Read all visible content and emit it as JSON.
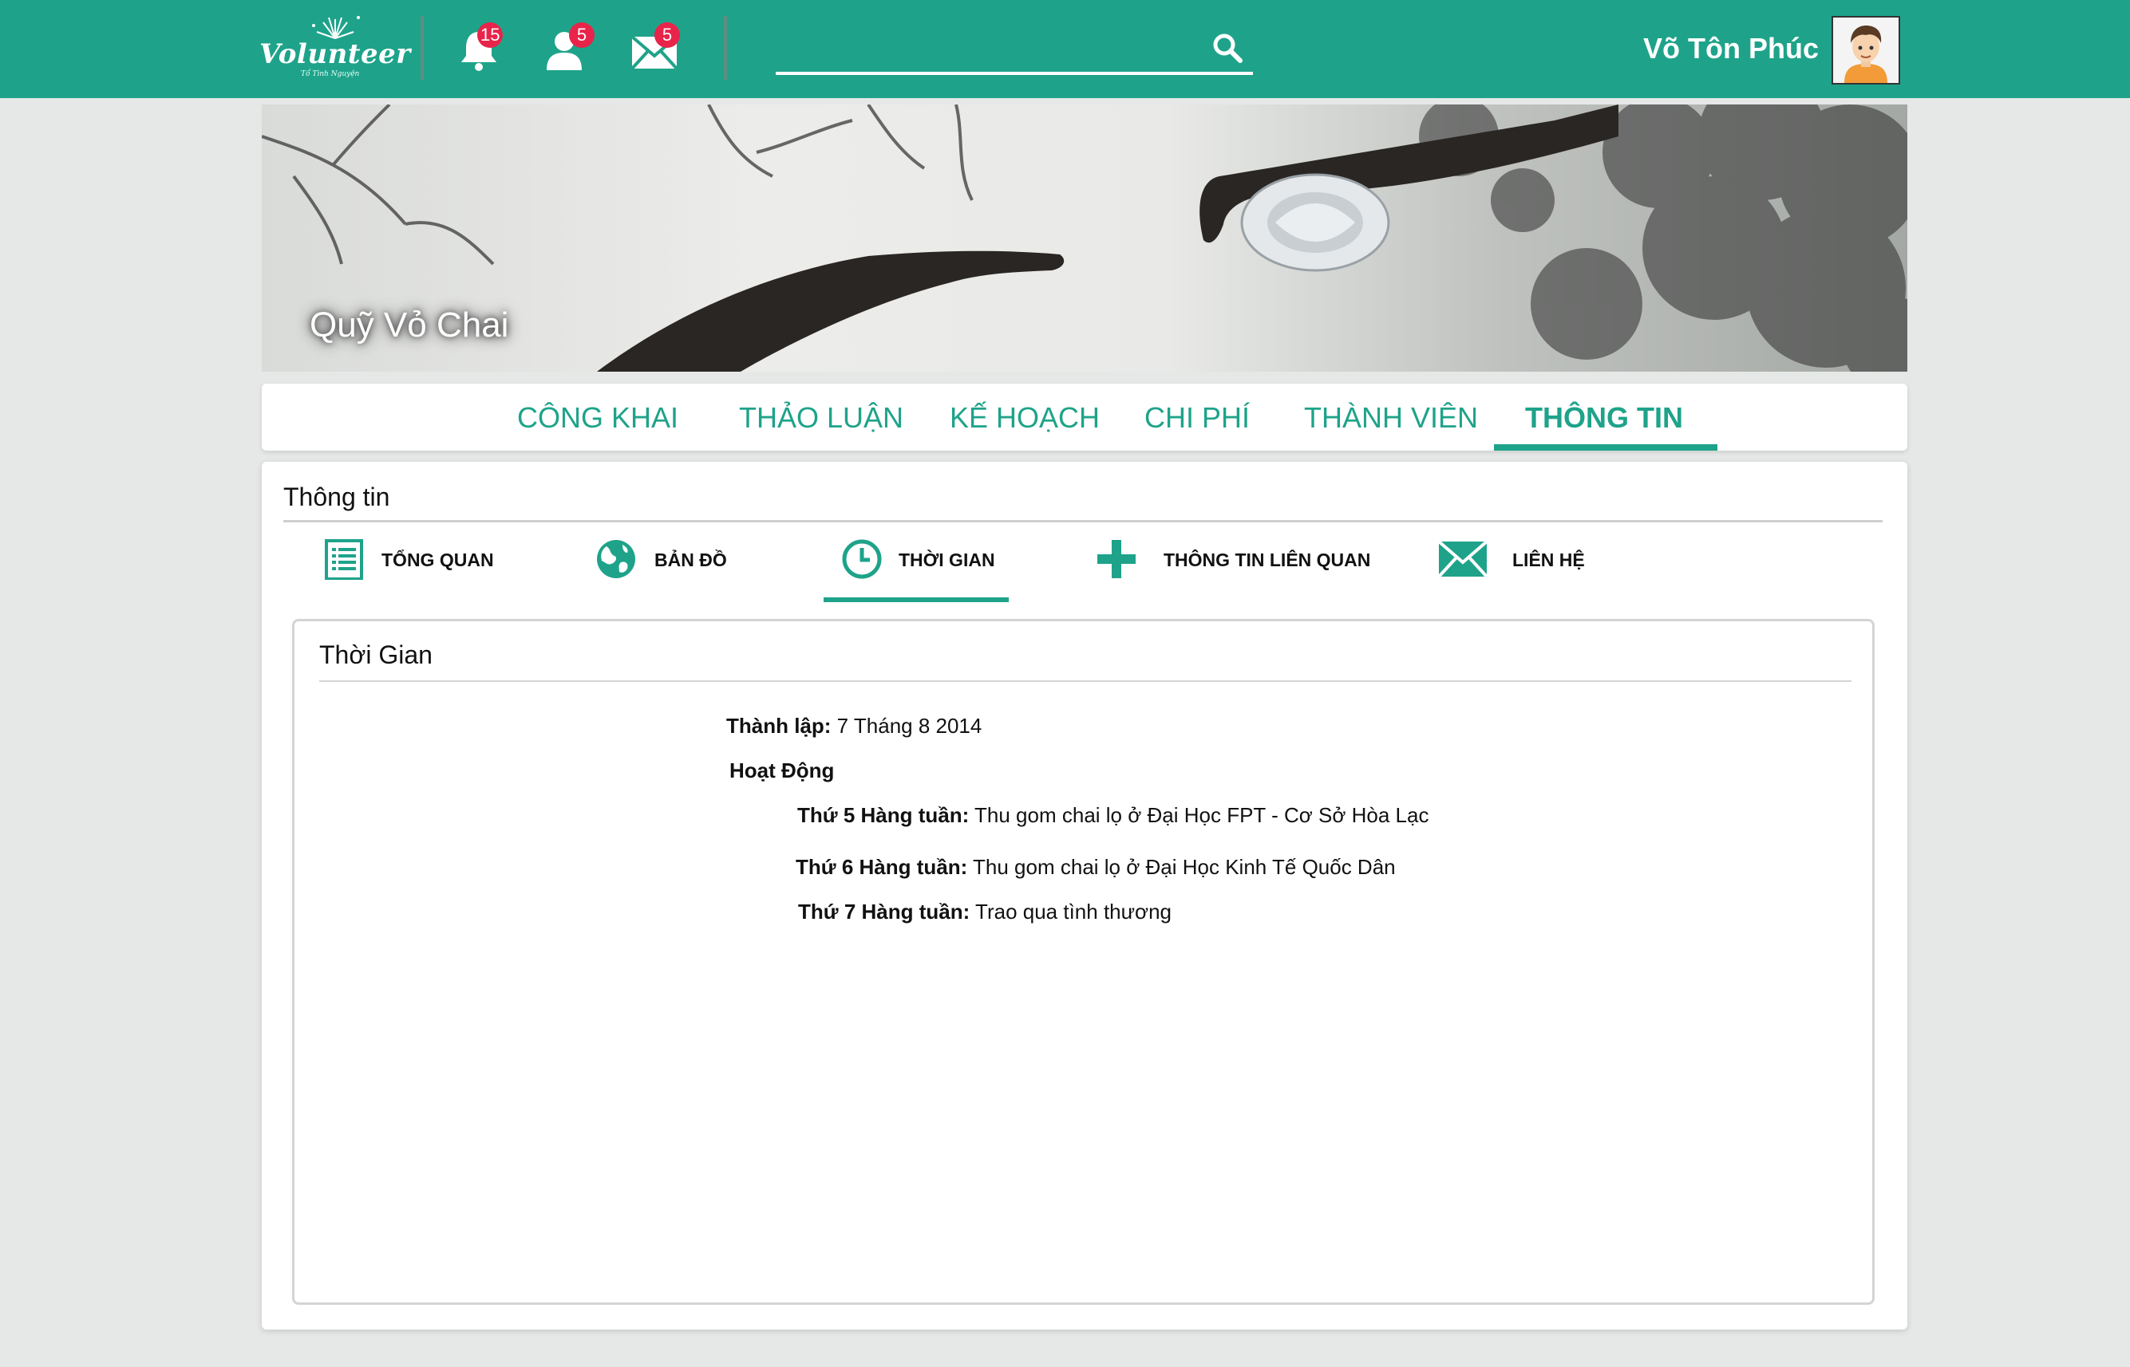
{
  "header": {
    "logo_text": "Volunteer",
    "logo_tagline": "Tổ Tình Nguyện",
    "notifications": {
      "icon": "bell-icon",
      "count": "15"
    },
    "friend_requests": {
      "icon": "user-icon",
      "count": "5"
    },
    "messages": {
      "icon": "envelope-icon",
      "count": "5"
    },
    "search": {
      "placeholder": "",
      "value": ""
    },
    "user_name": "Võ Tôn Phúc"
  },
  "banner": {
    "title": "Quỹ Vỏ Chai"
  },
  "tabs": [
    {
      "label": "CÔNG KHAI",
      "active": false
    },
    {
      "label": "THẢO LUẬN",
      "active": false
    },
    {
      "label": "KẾ HOẠCH",
      "active": false
    },
    {
      "label": "CHI PHÍ",
      "active": false
    },
    {
      "label": "THÀNH VIÊN",
      "active": false
    },
    {
      "label": "THÔNG TIN",
      "active": true
    }
  ],
  "info": {
    "title": "Thông tin",
    "subtabs": [
      {
        "label": "TỔNG QUAN",
        "icon": "list-icon"
      },
      {
        "label": "BẢN ĐỒ",
        "icon": "globe-icon"
      },
      {
        "label": "THỜI GIAN",
        "icon": "clock-icon",
        "active": true
      },
      {
        "label": "THÔNG TIN LIÊN QUAN",
        "icon": "plus-icon"
      },
      {
        "label": "LIÊN HỆ",
        "icon": "mail-icon"
      }
    ],
    "section": {
      "title": "Thời Gian",
      "founded_label": "Thành lập:",
      "founded_value": "7 Tháng 8 2014",
      "activities_label": "Hoạt Động",
      "activities": [
        {
          "day": "Thứ 5 Hàng tuần:",
          "text": "Thu gom chai lọ ở Đại Học FPT - Cơ Sở Hòa Lạc"
        },
        {
          "day": "Thứ 6 Hàng tuần:",
          "text": "Thu gom chai lọ ở Đại Học Kinh Tế Quốc Dân"
        },
        {
          "day": "Thứ 7 Hàng tuần:",
          "text": "Trao qua tình thương"
        }
      ]
    }
  },
  "colors": {
    "accent": "#1ea38a",
    "badge": "#e8244a",
    "background": "#e6e8e7"
  }
}
